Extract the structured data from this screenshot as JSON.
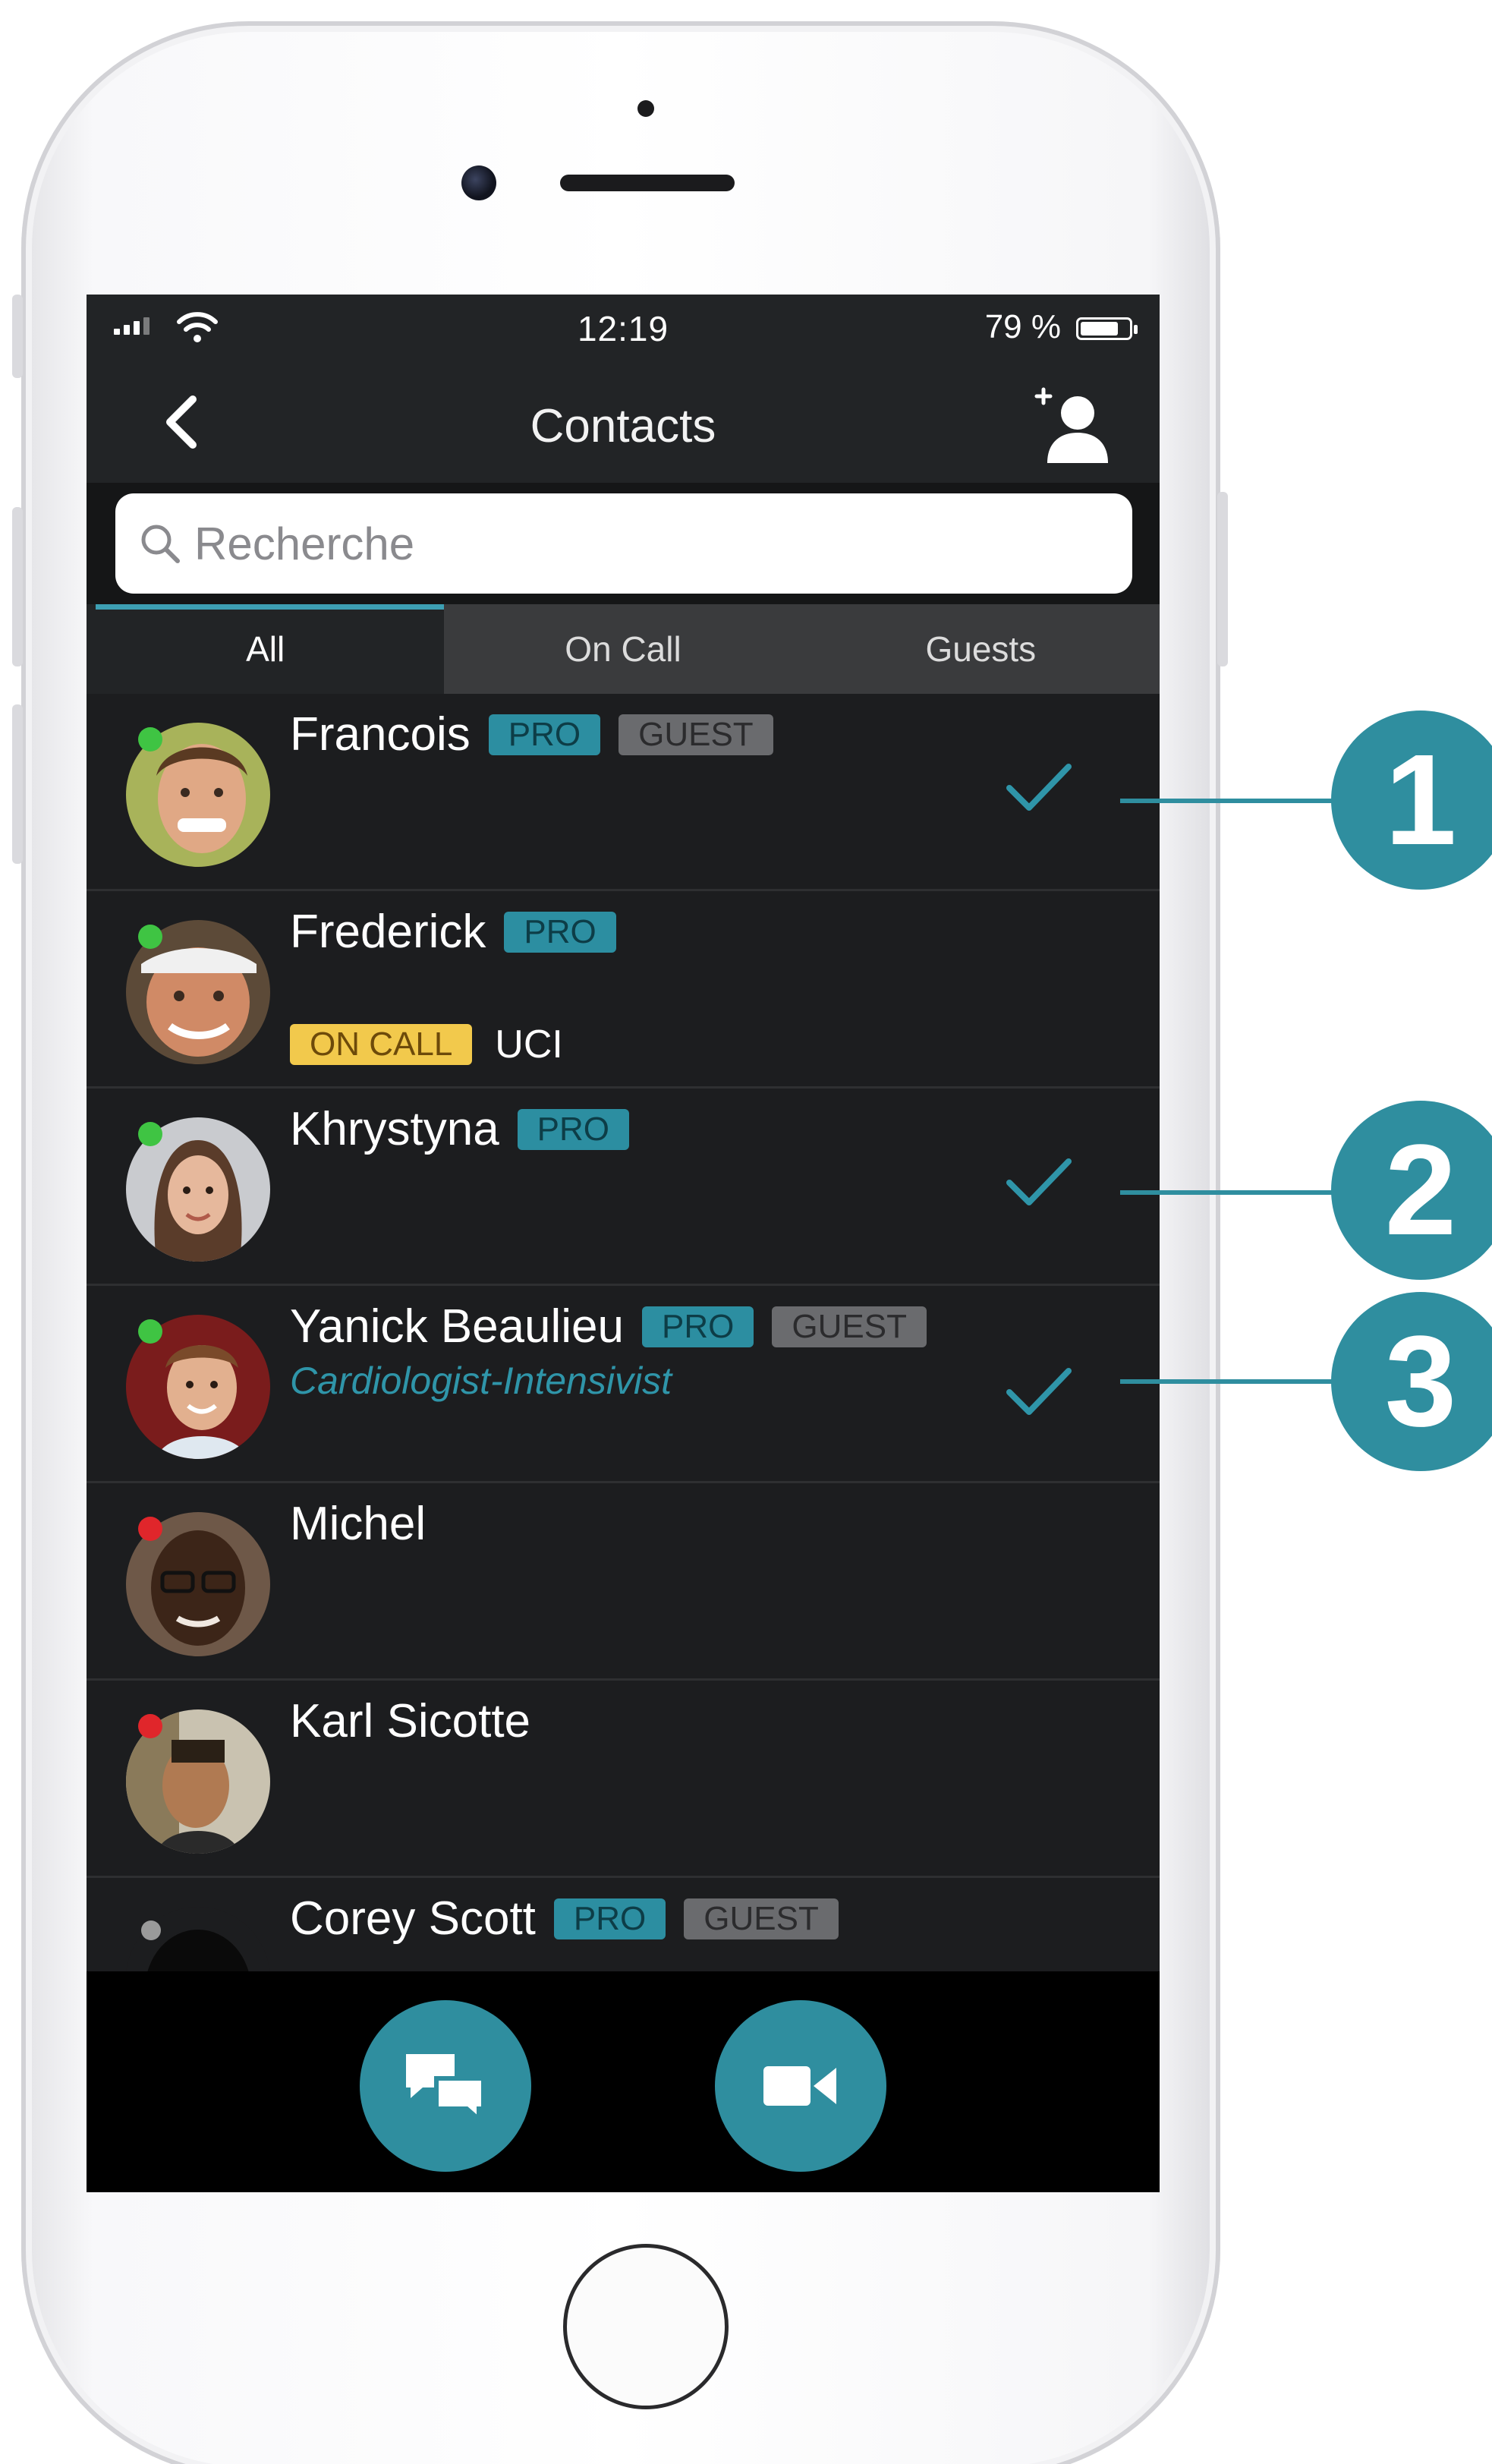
{
  "status_bar": {
    "time": "12:19",
    "battery": "79 %",
    "battery_level": 0.79
  },
  "nav": {
    "title": "Contacts"
  },
  "search": {
    "placeholder": "Recherche"
  },
  "tabs": [
    {
      "label": "All",
      "active": true
    },
    {
      "label": "On Call",
      "active": false
    },
    {
      "label": "Guests",
      "active": false
    }
  ],
  "contacts": [
    {
      "name": "Francois",
      "badges": [
        "PRO",
        "GUEST"
      ],
      "status": "online",
      "selected": true
    },
    {
      "name": "Frederick",
      "badges": [
        "PRO"
      ],
      "status": "online",
      "on_call": "ON CALL",
      "unit": "UCI",
      "selected": false
    },
    {
      "name": "Khrystyna",
      "badges": [
        "PRO"
      ],
      "status": "online",
      "selected": true
    },
    {
      "name": "Yanick Beaulieu",
      "badges": [
        "PRO",
        "GUEST"
      ],
      "status": "online",
      "title": "Cardiologist-Intensivist",
      "selected": true
    },
    {
      "name": "Michel",
      "badges": [],
      "status": "busy",
      "selected": false
    },
    {
      "name": "Karl Sicotte",
      "badges": [],
      "status": "busy",
      "selected": false
    },
    {
      "name": "Corey Scott",
      "badges": [
        "PRO",
        "GUEST"
      ],
      "status": "offline",
      "selected": false
    }
  ],
  "callouts": [
    "1",
    "2",
    "3"
  ],
  "colors": {
    "accent": "#2f8e9f",
    "online": "#3fc443",
    "busy": "#e0262b",
    "offline": "#9a9a9a",
    "oncall": "#f2c94c"
  },
  "icons": {
    "back": "chevron-left-icon",
    "add_contact": "add-contact-icon",
    "search": "search-icon",
    "check": "check-icon",
    "chat": "chat-icon",
    "video": "video-camera-icon"
  }
}
